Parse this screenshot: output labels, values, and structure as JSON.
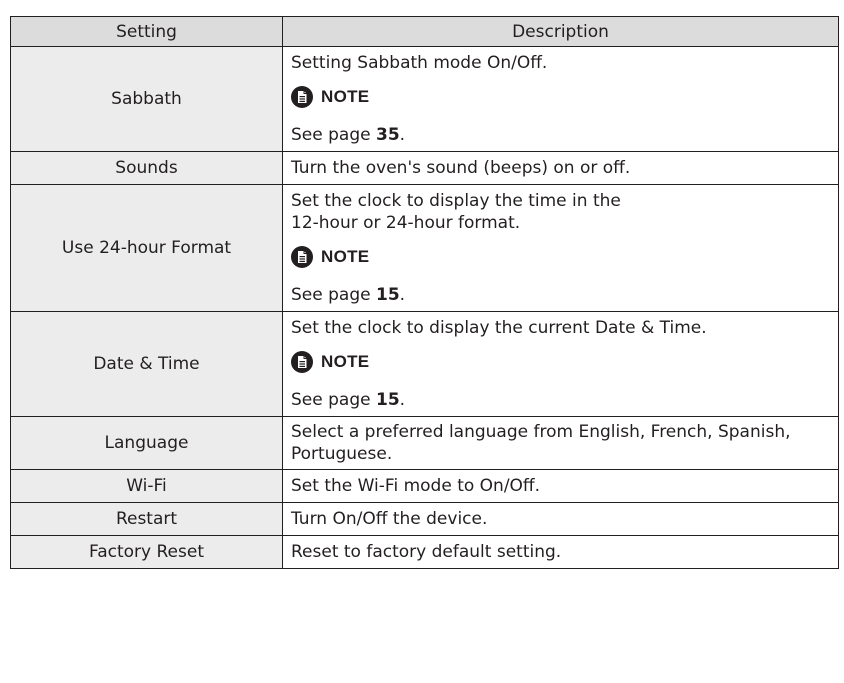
{
  "header": {
    "col_setting": "Setting",
    "col_description": "Description"
  },
  "rows": [
    {
      "setting": "Sabbath",
      "description": "Setting Sabbath mode On/Off.",
      "note_label": "NOTE",
      "note_text": "See page ",
      "note_page": "35",
      "note_end": "."
    },
    {
      "setting": "Sounds",
      "description": "Turn the oven's sound (beeps) on or off."
    },
    {
      "setting": "Use 24-hour Format",
      "description": "Set the clock to display the time in the 12-hour or 24-hour format.",
      "note_label": "NOTE",
      "note_text": "See page ",
      "note_page": "15",
      "note_end": "."
    },
    {
      "setting": "Date & Time",
      "description": "Set the clock to display the current Date & Time.",
      "note_label": "NOTE",
      "note_text": "See page ",
      "note_page": "15",
      "note_end": "."
    },
    {
      "setting": "Language",
      "description": "Select a preferred language from English, French, Spanish, Portuguese."
    },
    {
      "setting": "Wi-Fi",
      "description": "Set the Wi-Fi mode to On/Off."
    },
    {
      "setting": "Restart",
      "description": "Turn On/Off the device."
    },
    {
      "setting": "Factory Reset",
      "description": "Reset to factory default setting."
    }
  ],
  "icons": {
    "note": "note-document-icon"
  }
}
